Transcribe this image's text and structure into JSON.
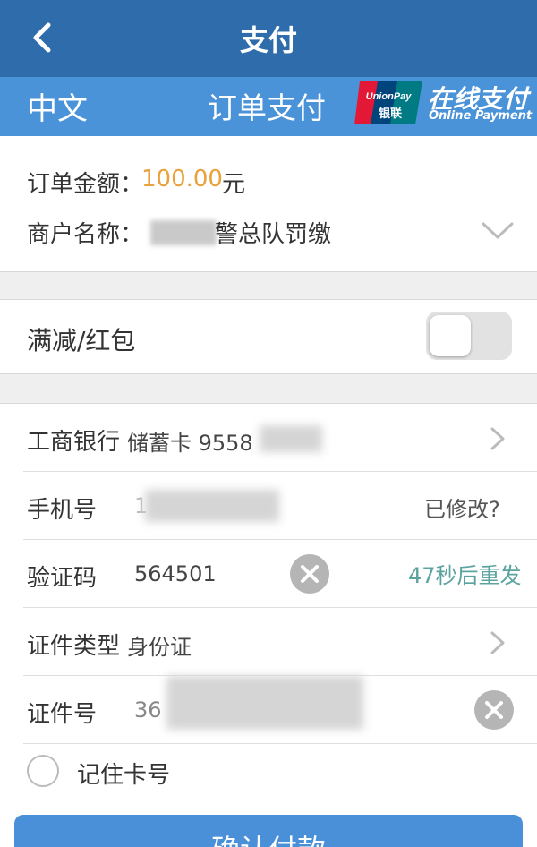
{
  "header": {
    "title": "支付"
  },
  "subbar": {
    "language": "中文",
    "order_pay": "订单支付",
    "logo_text_top": "UnionPay",
    "logo_text_bottom": "银联",
    "online_cn": "在线支付",
    "online_en": "Online Payment"
  },
  "order": {
    "amount_label": "订单金额：",
    "amount_value": "100.00",
    "amount_unit": "元",
    "merchant_label": "商户名称：",
    "merchant_value": "警总队罚缴"
  },
  "discount": {
    "label": "满减/红包",
    "enabled": false
  },
  "form": {
    "bank": {
      "label": "工商银行",
      "value": "储蓄卡 9558"
    },
    "phone": {
      "label": "手机号",
      "value": "1",
      "action": "已修改?"
    },
    "code": {
      "label": "验证码",
      "value": "564501",
      "resend": "47秒后重发"
    },
    "id_type": {
      "label": "证件类型",
      "value": "身份证"
    },
    "id_no": {
      "label": "证件号",
      "value": "36"
    },
    "remember": {
      "label": "记住卡号"
    }
  },
  "confirm": {
    "label": "确认付款"
  },
  "colors": {
    "header": "#2f6cab",
    "subbar": "#4b93d8",
    "amount": "#e9a13b",
    "resend": "#5aa39e",
    "button": "#4a90d9"
  }
}
